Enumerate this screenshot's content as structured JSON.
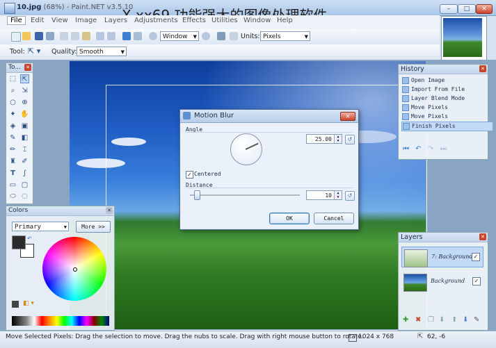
{
  "window": {
    "title": "10.jpg (68%) - Paint.NET v3.5.10",
    "title_file": "10.jpg",
    "title_rest": "(68%) - Paint.NET v3.5.10",
    "overlay_caption": "X xx69 功能强大的图像处理软件"
  },
  "menu": {
    "items": [
      "File",
      "Edit",
      "View",
      "Image",
      "Layers",
      "Adjustments",
      "Effects",
      "Utilities",
      "Window",
      "Help"
    ]
  },
  "toolbar": {
    "zoom_combo": "Window",
    "units_label": "Units:",
    "units_combo": "Pixels",
    "tool_label": "Tool:",
    "quality_label": "Quality:",
    "quality_combo": "Smooth"
  },
  "tools_panel": {
    "title": "To..."
  },
  "colors_panel": {
    "title": "Colors",
    "mode_combo": "Primary",
    "more_button": "More >>"
  },
  "history_panel": {
    "title": "History",
    "items": [
      "Open Image",
      "Import From File",
      "Layer Blend Mode",
      "Move Pixels",
      "Move Pixels",
      "Finish Pixels"
    ]
  },
  "layers_panel": {
    "title": "Layers",
    "layers": [
      {
        "name": "7: Background",
        "visible": true,
        "selected": true
      },
      {
        "name": "Background",
        "visible": true,
        "selected": false
      }
    ]
  },
  "dialog": {
    "title": "Motion Blur",
    "angle_label": "Angle",
    "angle_value": "25.00",
    "centered_label": "Centered",
    "centered_checked": true,
    "distance_label": "Distance",
    "distance_value": "10",
    "ok_label": "OK",
    "cancel_label": "Cancel"
  },
  "status": {
    "hint": "Move Selected Pixels: Drag the selection to move. Drag the nubs to scale. Drag with right mouse button to rotate.",
    "image_size": "1024 x 768",
    "cursor_pos": "62, -6"
  },
  "colors": {
    "accent": "#5d8fd1",
    "close_red": "#c8442b"
  }
}
